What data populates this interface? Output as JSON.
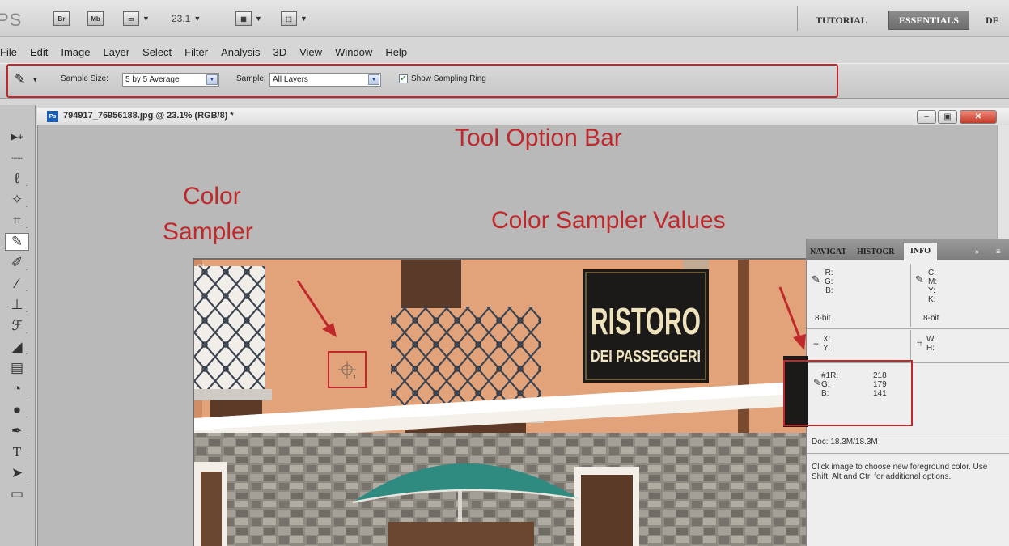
{
  "app": {
    "logo": "PS",
    "bridge_label": "Br",
    "minibridge_label": "Mb",
    "zoom": "23.1",
    "workspaces": [
      "TUTORIAL",
      "ESSENTIALS",
      "DE"
    ]
  },
  "menu": [
    "File",
    "Edit",
    "Image",
    "Layer",
    "Select",
    "Filter",
    "Analysis",
    "3D",
    "View",
    "Window",
    "Help"
  ],
  "options": {
    "sample_size_label": "Sample Size:",
    "sample_size_value": "5 by 5 Average",
    "sample_label": "Sample:",
    "sample_value": "All Layers",
    "show_ring_label": "Show Sampling Ring",
    "show_ring_checked": true
  },
  "document": {
    "title": "794917_76956188.jpg @ 23.1% (RGB/8) *",
    "sign_line1": "RISTORO",
    "sign_line2": "DEI PASSEGGERI"
  },
  "annotations": {
    "tool_option_bar": "Tool Option Bar",
    "color_sampler_line1": "Color",
    "color_sampler_line2": "Sampler",
    "color_sampler_values": "Color Sampler Values"
  },
  "panel": {
    "tabs": [
      "NAVIGAT",
      "HISTOGR",
      "INFO"
    ],
    "rgb_block": "R:\nG:\nB:",
    "cmyk_block": "C:\nM:\nY:\nK:",
    "bitdepth_left": "8-bit",
    "bitdepth_right": "8-bit",
    "xy_block": "X:\nY:",
    "wh_block": "W:\nH:",
    "sampler_labels": "#1R:\nG:\nB:",
    "sampler_values": [
      "218",
      "179",
      "141"
    ],
    "doc_size": "Doc: 18.3M/18.3M",
    "hint": "Click image to choose new foreground color.  Use Shift, Alt and Ctrl for additional options."
  },
  "colors": {
    "accent_red": "#c0292c",
    "wall": "#e3a47d",
    "umbrella": "#2f8a80"
  }
}
